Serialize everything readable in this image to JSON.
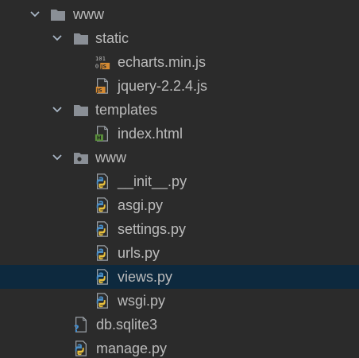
{
  "project_tree": {
    "root_label": "www",
    "static_folder": "static",
    "static_files": [
      "echarts.min.js",
      "jquery-2.2.4.js"
    ],
    "templates_folder": "templates",
    "template_files": [
      "index.html"
    ],
    "package_folder": "www",
    "package_files": [
      "__init__.py",
      "asgi.py",
      "settings.py",
      "urls.py",
      "views.py",
      "wsgi.py"
    ],
    "root_files": [
      "db.sqlite3",
      "manage.py"
    ],
    "selected_item": "views.py"
  },
  "icons": {
    "folder": "folder-icon",
    "package": "python-package-icon",
    "js": "js-file-icon",
    "minified_js": "binary-js-file-icon",
    "html": "html-file-icon",
    "python": "python-file-icon",
    "sqlite": "unknown-file-icon",
    "chevron": "chevron-down-icon"
  },
  "colors": {
    "background": "#2b2b2b",
    "selection": "#0d293e",
    "text": "#bbbbbb",
    "folder": "#8a8f96",
    "python_blue": "#4a8fc7",
    "python_yellow": "#e8c03e",
    "js_badge": "#d58a32",
    "html_badge": "#5a8f3c",
    "unknown_mark": "#3f8fd6"
  }
}
